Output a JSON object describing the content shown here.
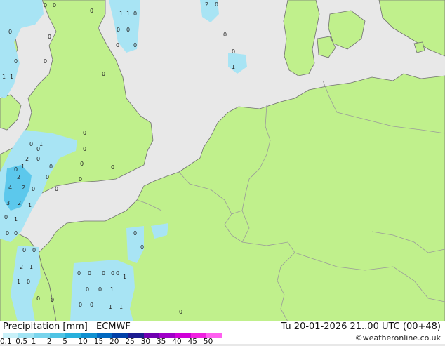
{
  "footer": {
    "title": "Precipitation [mm]",
    "model": "ECMWF",
    "valid_time": "Tu 20-01-2026 21..00 UTC (00+48)",
    "credit": "©weatheronline.co.uk"
  },
  "legend": {
    "ticks": [
      "0.1",
      "0.5",
      "1",
      "2",
      "5",
      "10",
      "15",
      "20",
      "25",
      "30",
      "35",
      "40",
      "45",
      "50"
    ],
    "colors": [
      "#c8f0f8",
      "#a0e4f4",
      "#78d4ec",
      "#50c4e4",
      "#28b0dc",
      "#1090d0",
      "#0068c0",
      "#0040a8",
      "#1c1c90",
      "#7000b0",
      "#a000c8",
      "#d000d8",
      "#f020e0",
      "#ff60f0"
    ]
  },
  "colors": {
    "sea": "#e8e8e8",
    "land": "#c0f08c",
    "border": "#9a9a9a",
    "coast": "#707070",
    "rain_light": "#a8e4f4",
    "rain_medium": "#5cc8ec"
  },
  "map_labels": [
    "0",
    "0",
    "1",
    "1",
    "0",
    "0",
    "0",
    "2",
    "0",
    "0",
    "0",
    "1",
    "0",
    "0",
    "1",
    "1",
    "0",
    "0",
    "0",
    "1",
    "0",
    "0",
    "0",
    "2",
    "0",
    "1",
    "0",
    "2",
    "0",
    "4",
    "2",
    "0",
    "0",
    "3",
    "2",
    "1",
    "0",
    "1",
    "0",
    "0",
    "0",
    "0",
    "0",
    "0",
    "2",
    "1",
    "1",
    "0",
    "0",
    "0",
    "0",
    "0",
    "0",
    "0",
    "0",
    "1",
    "1",
    "0",
    "0",
    "0",
    "1",
    "0",
    "1",
    "0",
    "0",
    "0",
    "0",
    "0",
    "0",
    "0",
    "0",
    "0"
  ]
}
